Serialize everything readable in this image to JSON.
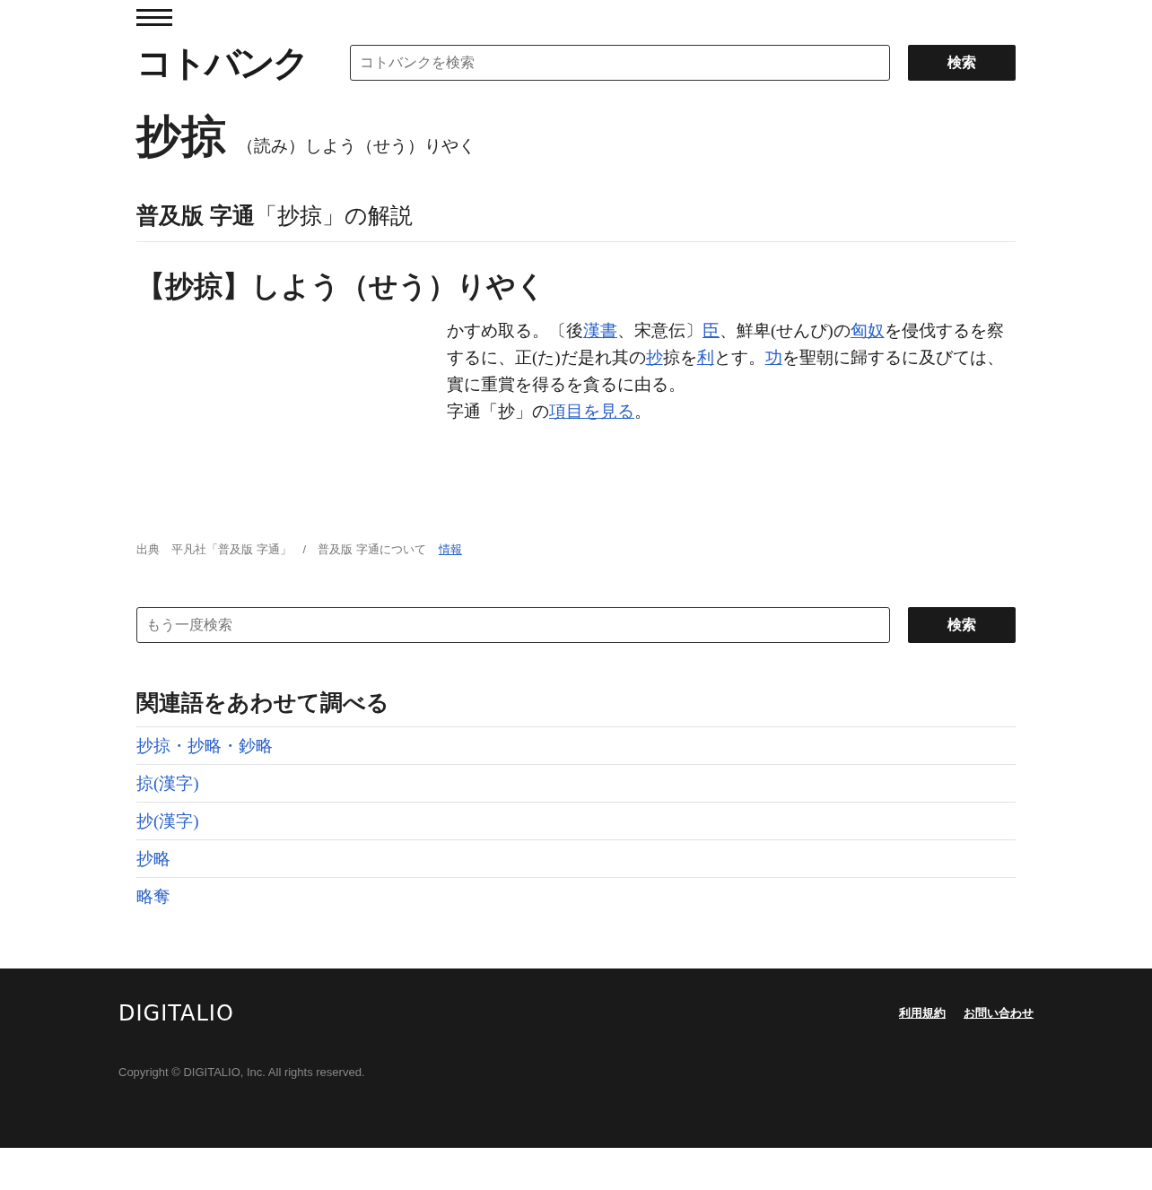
{
  "header": {
    "logo": "コトバンク",
    "search": {
      "placeholder": "コトバンクを検索",
      "button": "検索"
    }
  },
  "entry": {
    "title": "抄掠",
    "reading": "（読み）しよう（せう）りやく"
  },
  "section": {
    "source_bold": "普及版 字通",
    "heading": "「抄掠」の解説",
    "headword": "【抄掠】しよう（せう）りやく",
    "paragraphs": [
      [
        {
          "text": "かすめ取る。〔後",
          "link": false
        },
        {
          "text": "漢書",
          "link": true
        },
        {
          "text": "、宋意伝〕",
          "link": false
        },
        {
          "text": "臣",
          "link": true
        },
        {
          "text": "、鮮卑(せんぴ)の",
          "link": false
        },
        {
          "text": "匈奴",
          "link": true
        },
        {
          "text": "を侵伐するを察するに、正(た)だ是れ其の",
          "link": false
        },
        {
          "text": "抄",
          "link": true
        },
        {
          "text": "掠を",
          "link": false
        },
        {
          "text": "利",
          "link": true
        },
        {
          "text": "とす。",
          "link": false
        },
        {
          "text": "功",
          "link": true
        },
        {
          "text": "を聖朝に歸するに及びては、實に重賞を得るを貪るに由る。",
          "link": false
        }
      ],
      [
        {
          "text": "字通「抄」の",
          "link": false
        },
        {
          "text": "項目を見る",
          "link": true
        },
        {
          "text": "。",
          "link": false
        }
      ]
    ],
    "credit": "出典　平凡社「普及版 字通」　/　普及版 字通について",
    "credit_link": "情報"
  },
  "search_again": {
    "placeholder": "もう一度検索",
    "button": "検索"
  },
  "related": {
    "heading": "関連語をあわせて調べる",
    "items": [
      "抄掠・抄略・鈔略",
      "掠(漢字)",
      "抄(漢字)",
      "抄略",
      "略奪"
    ]
  },
  "footer": {
    "logo": "DIGITALIO",
    "links": [
      "利用規約",
      "お問い合わせ"
    ],
    "copyright": "Copyright © DIGITALIO, Inc. All rights reserved."
  }
}
